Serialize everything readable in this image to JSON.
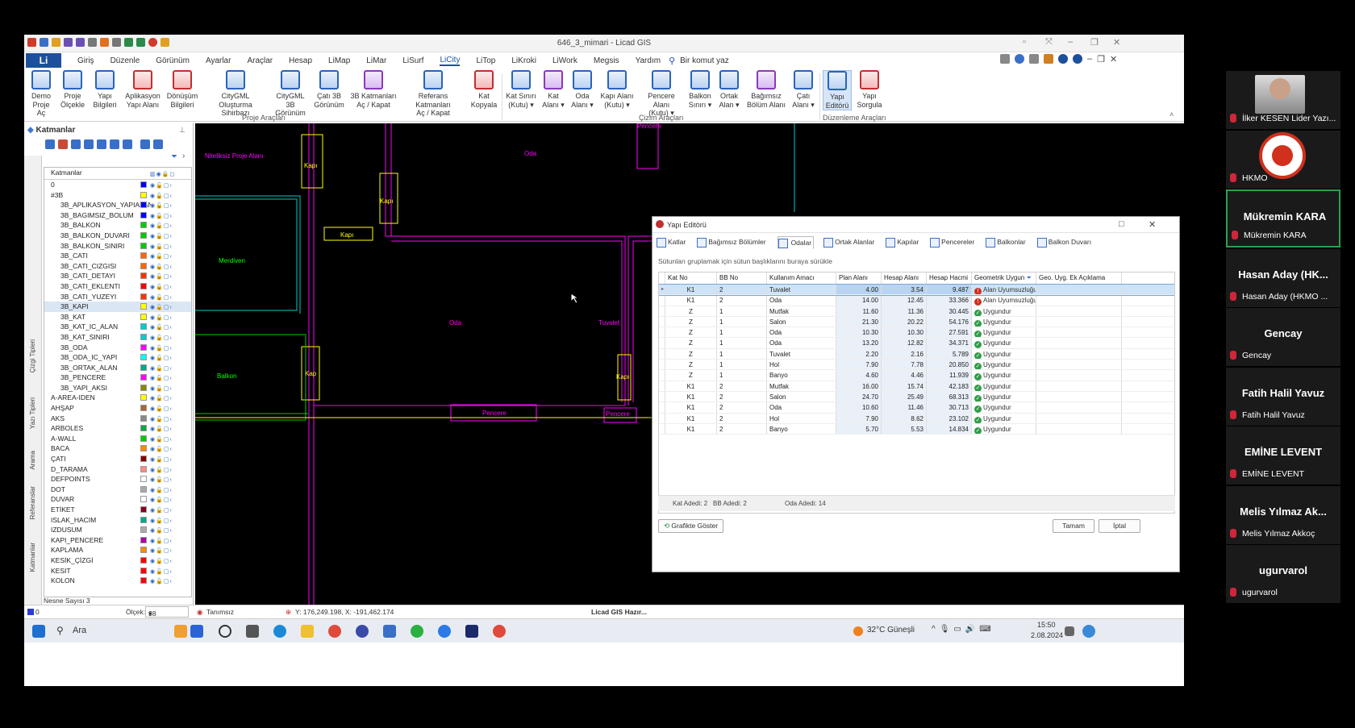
{
  "app": {
    "title": "646_3_mimari - Licad GIS",
    "logo": "Li"
  },
  "menu": [
    "Giriş",
    "Düzenle",
    "Görünüm",
    "Ayarlar",
    "Araçlar",
    "Hesap",
    "LiMap",
    "LiMar",
    "LiSurf",
    "LiCity",
    "LiTop",
    "LiKroki",
    "LiWork",
    "Megsis",
    "Yardım"
  ],
  "search_label": "Bir komut yaz",
  "ribbon": {
    "buttons": [
      "Demo\nProje Aç",
      "Proje\nÖlçekle",
      "Yapı\nBilgileri",
      "Aplikasyon\nYapı Alanı",
      "Dönüşüm\nBilgileri",
      "CityGML\nOluşturma Sihirbazı",
      "CityGML 3B\nGörünüm",
      "Çatı 3B\nGörünüm",
      "3B Katmanları\nAç / Kapat",
      "Referans Katmanları\nAç / Kapat",
      "Kat\nKopyala",
      "Kat Sınırı\n(Kutu) ▾",
      "Kat\nAlanı ▾",
      "Oda\nAlanı ▾",
      "Kapı Alanı\n(Kutu) ▾",
      "Pencere Alanı\n(Kutu) ▾",
      "Balkon\nSınırı ▾",
      "Ortak\nAlan ▾",
      "Bağımsız\nBölüm Alanı",
      "Çatı\nAlanı ▾",
      "Yapı\nEditörü",
      "Yapı\nSorgula"
    ],
    "groups": [
      "Proje Araçları",
      "Çizim Araçları",
      "Düzenleme Araçları"
    ]
  },
  "layers_panel": {
    "title": "Katmanlar",
    "header": "Katmanlar",
    "side_tabs": [
      "Katmanlar",
      "Referanslar",
      "Arama",
      "Yazı Tipleri",
      "Çizgi Tipleri"
    ],
    "rows": [
      {
        "name": "0",
        "color": "#0000ff"
      },
      {
        "name": "#3B",
        "color": "#ffff00"
      },
      {
        "name": "3B_APLIKASYON_YAPIALANI",
        "color": "#0000ff"
      },
      {
        "name": "3B_BAGIMSIZ_BOLUM",
        "color": "#0000ff"
      },
      {
        "name": "3B_BALKON",
        "color": "#00cc00"
      },
      {
        "name": "3B_BALKON_DUVARI",
        "color": "#00cc00"
      },
      {
        "name": "3B_BALKON_SINIRI",
        "color": "#00cc00"
      },
      {
        "name": "3B_CATI",
        "color": "#ff6600"
      },
      {
        "name": "3B_CATI_CIZGISI",
        "color": "#ff6600"
      },
      {
        "name": "3B_CATI_DETAYI",
        "color": "#ff3300"
      },
      {
        "name": "3B_CATI_EKLENTI",
        "color": "#ff0000"
      },
      {
        "name": "3B_CATI_YUZEYI",
        "color": "#ff3300"
      },
      {
        "name": "3B_KAPI",
        "color": "#ffff00"
      },
      {
        "name": "3B_KAT",
        "color": "#ffff00"
      },
      {
        "name": "3B_KAT_IC_ALAN",
        "color": "#00cccc"
      },
      {
        "name": "3B_KAT_SINIRI",
        "color": "#00cccc"
      },
      {
        "name": "3B_ODA",
        "color": "#ff00ff"
      },
      {
        "name": "3B_ODA_IC_YAPI",
        "color": "#00ffff"
      },
      {
        "name": "3B_ORTAK_ALAN",
        "color": "#00aa88"
      },
      {
        "name": "3B_PENCERE",
        "color": "#ff00ff"
      },
      {
        "name": "3B_YAPI_AKSI",
        "color": "#888800"
      },
      {
        "name": "A-AREA-IDEN",
        "color": "#ffff00"
      },
      {
        "name": "AHŞAP",
        "color": "#aa6633"
      },
      {
        "name": "AKS",
        "color": "#888888"
      },
      {
        "name": "ARBOLES",
        "color": "#00aa44"
      },
      {
        "name": "A-WALL",
        "color": "#00cc00"
      },
      {
        "name": "BACA",
        "color": "#ff8800"
      },
      {
        "name": "ÇATI",
        "color": "#880000"
      },
      {
        "name": "D_TARAMA",
        "color": "#ff8888"
      },
      {
        "name": "DEFPOINTS",
        "color": "#ffffff"
      },
      {
        "name": "DOT",
        "color": "#aaaaaa"
      },
      {
        "name": "DUVAR",
        "color": "#ffffff"
      },
      {
        "name": "ETİKET",
        "color": "#880022"
      },
      {
        "name": "ISLAK_HACIM",
        "color": "#00aa88"
      },
      {
        "name": "IZDUSUM",
        "color": "#aaaaaa"
      },
      {
        "name": "KAPI_PENCERE",
        "color": "#aa00aa"
      },
      {
        "name": "KAPLAMA",
        "color": "#ff8800"
      },
      {
        "name": "KESİK_ÇİZGİ",
        "color": "#ff0000"
      },
      {
        "name": "KESIT",
        "color": "#ff0000"
      },
      {
        "name": "KOLON",
        "color": "#ff0000"
      }
    ],
    "status": "Nesne Sayısı   3"
  },
  "cad_labels": [
    {
      "text": "Niteliksiz Proje Alanı",
      "color": "#ff00ff"
    },
    {
      "text": "Oda",
      "color": "#ff00ff"
    },
    {
      "text": "Kapı",
      "color": "#ffff00"
    },
    {
      "text": "Kapı",
      "color": "#ffff00"
    },
    {
      "text": "Kapı",
      "color": "#ffff00"
    },
    {
      "text": "Merdiven",
      "color": "#00ff00"
    },
    {
      "text": "Oda",
      "color": "#ff00ff"
    },
    {
      "text": "Tuvalet",
      "color": "#ff00ff"
    },
    {
      "text": "Balkon",
      "color": "#00ff00"
    },
    {
      "text": "Kap",
      "color": "#ffff00"
    },
    {
      "text": "Kapı",
      "color": "#ffff00"
    },
    {
      "text": "Pencere",
      "color": "#ff00ff"
    },
    {
      "text": "Pencere",
      "color": "#ff00ff"
    },
    {
      "text": "Pencere",
      "color": "#ff00ff"
    }
  ],
  "dialog": {
    "title": "Yapı Editörü",
    "tabs": [
      "Katlar",
      "Bağımsız Bölümler",
      "Odalar",
      "Ortak Alanlar",
      "Kapılar",
      "Pencereler",
      "Balkonlar",
      "Balkon Duvarı"
    ],
    "group_hint": "Sütunları gruplamak için sütun başlıklarını buraya sürükle",
    "columns": [
      "Kat No",
      "BB No",
      "Kullanım Amacı",
      "Plan Alanı",
      "Hesap Alanı",
      "Hesap Hacmi",
      "Geometrik Uygun",
      "Geo. Uyg. Ek Açıklama"
    ],
    "rows": [
      {
        "kat": "K1",
        "bb": "2",
        "amac": "Tuvalet",
        "plan": "4.00",
        "alan": "3.54",
        "hacim": "9.487",
        "status": "Alan Uyumsuzluğu",
        "ok": false
      },
      {
        "kat": "K1",
        "bb": "2",
        "amac": "Oda",
        "plan": "14.00",
        "alan": "12.45",
        "hacim": "33.366",
        "status": "Alan Uyumsuzluğu",
        "ok": false
      },
      {
        "kat": "Z",
        "bb": "1",
        "amac": "Mutfak",
        "plan": "11.60",
        "alan": "11.36",
        "hacim": "30.445",
        "status": "Uygundur",
        "ok": true
      },
      {
        "kat": "Z",
        "bb": "1",
        "amac": "Salon",
        "plan": "21.30",
        "alan": "20.22",
        "hacim": "54.176",
        "status": "Uygundur",
        "ok": true
      },
      {
        "kat": "Z",
        "bb": "1",
        "amac": "Oda",
        "plan": "10.30",
        "alan": "10.30",
        "hacim": "27.591",
        "status": "Uygundur",
        "ok": true
      },
      {
        "kat": "Z",
        "bb": "1",
        "amac": "Oda",
        "plan": "13.20",
        "alan": "12.82",
        "hacim": "34.371",
        "status": "Uygundur",
        "ok": true
      },
      {
        "kat": "Z",
        "bb": "1",
        "amac": "Tuvalet",
        "plan": "2.20",
        "alan": "2.16",
        "hacim": "5.789",
        "status": "Uygundur",
        "ok": true
      },
      {
        "kat": "Z",
        "bb": "1",
        "amac": "Hol",
        "plan": "7.90",
        "alan": "7.78",
        "hacim": "20.850",
        "status": "Uygundur",
        "ok": true
      },
      {
        "kat": "Z",
        "bb": "1",
        "amac": "Banyo",
        "plan": "4.60",
        "alan": "4.46",
        "hacim": "11.939",
        "status": "Uygundur",
        "ok": true
      },
      {
        "kat": "K1",
        "bb": "2",
        "amac": "Mutfak",
        "plan": "16.00",
        "alan": "15.74",
        "hacim": "42.183",
        "status": "Uygundur",
        "ok": true
      },
      {
        "kat": "K1",
        "bb": "2",
        "amac": "Salon",
        "plan": "24.70",
        "alan": "25.49",
        "hacim": "68.313",
        "status": "Uygundur",
        "ok": true
      },
      {
        "kat": "K1",
        "bb": "2",
        "amac": "Oda",
        "plan": "10.60",
        "alan": "11.46",
        "hacim": "30.713",
        "status": "Uygundur",
        "ok": true
      },
      {
        "kat": "K1",
        "bb": "2",
        "amac": "Hol",
        "plan": "7.90",
        "alan": "8.62",
        "hacim": "23.102",
        "status": "Uygundur",
        "ok": true
      },
      {
        "kat": "K1",
        "bb": "2",
        "amac": "Banyo",
        "plan": "5.70",
        "alan": "5.53",
        "hacim": "14.834",
        "status": "Uygundur",
        "ok": true
      }
    ],
    "footer": {
      "kat": "Kat Adedi: 2",
      "bb": "BB Adedi: 2",
      "oda": "Oda Adedi: 14"
    },
    "buttons": {
      "graphic": "Grafikte Göster",
      "ok": "Tamam",
      "cancel": "İptal"
    }
  },
  "statusbar": {
    "layer": "0",
    "scale_label": "Ölçek:",
    "scale_value": "38",
    "mode": "Tanımsız",
    "coords": "Y: 176,249.198, X: -191,462.174",
    "ready": "Licad GIS Hazır..."
  },
  "taskbar": {
    "search": "Ara",
    "weather": "32°C  Güneşli",
    "time": "15:50",
    "date": "2.08.2024"
  },
  "participants": [
    {
      "tile": "",
      "label": "İlker KESEN Lider Yazı...",
      "type": "photo"
    },
    {
      "tile": "",
      "label": "HKMO",
      "type": "logo"
    },
    {
      "tile": "Mükremin KARA",
      "label": "Mükremin KARA",
      "type": "name",
      "active": true
    },
    {
      "tile": "Hasan Aday (HK...",
      "label": "Hasan Aday (HKMO ...",
      "type": "name"
    },
    {
      "tile": "Gencay",
      "label": "Gencay",
      "type": "name"
    },
    {
      "tile": "Fatih Halil Yavuz",
      "label": "Fatih Halil Yavuz",
      "type": "name"
    },
    {
      "tile": "EMİNE LEVENT",
      "label": "EMİNE LEVENT",
      "type": "name"
    },
    {
      "tile": "Melis Yılmaz Ak...",
      "label": "Melis Yılmaz Akkoç",
      "type": "name"
    },
    {
      "tile": "ugurvarol",
      "label": "ugurvarol",
      "type": "name"
    }
  ]
}
